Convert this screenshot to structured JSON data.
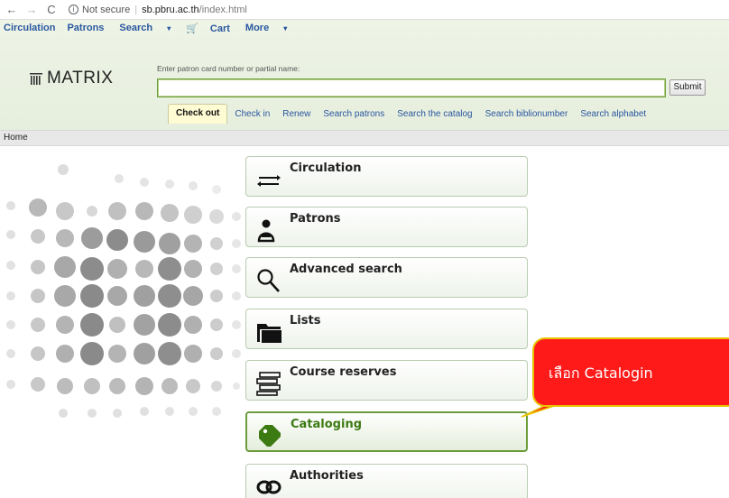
{
  "browser": {
    "back": "←",
    "forward": "→",
    "reload": "C",
    "security": "Not secure",
    "url_host": "sb.pbru.ac.th",
    "url_path": "/index.html"
  },
  "topnav": {
    "circulation": "Circulation",
    "patrons": "Patrons",
    "search": "Search",
    "cart": "Cart",
    "more": "More"
  },
  "logo": {
    "text": "MATRIX"
  },
  "patron_search": {
    "label": "Enter patron card number or partial name:",
    "value": "",
    "submit": "Submit"
  },
  "tabs": [
    {
      "label": "Check out"
    },
    {
      "label": "Check in"
    },
    {
      "label": "Renew"
    },
    {
      "label": "Search patrons"
    },
    {
      "label": "Search the catalog"
    },
    {
      "label": "Search biblionumber"
    },
    {
      "label": "Search alphabet"
    }
  ],
  "breadcrumb": {
    "home": "Home"
  },
  "menu": [
    {
      "label": "Circulation",
      "icon": "circulation-arrows-icon"
    },
    {
      "label": "Patrons",
      "icon": "patron-person-icon"
    },
    {
      "label": "Advanced search",
      "icon": "magnifier-icon"
    },
    {
      "label": "Lists",
      "icon": "folder-icon"
    },
    {
      "label": "Course reserves",
      "icon": "book-stack-icon"
    },
    {
      "label": "Cataloging",
      "icon": "tag-icon"
    },
    {
      "label": "Authorities",
      "icon": "chain-link-icon"
    }
  ],
  "callout": {
    "text": "เลือก Catalogin"
  },
  "colors": {
    "accent_green": "#6b9c3a",
    "link_blue": "#2a57a0",
    "callout_red": "#ff1a1a",
    "callout_border": "#e8c400"
  }
}
